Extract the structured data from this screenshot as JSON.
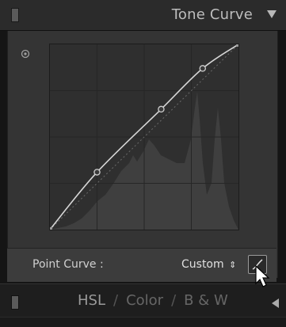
{
  "header": {
    "title": "Tone Curve",
    "icons": [
      "panel-grip",
      "collapse-triangle"
    ]
  },
  "curve": {
    "control_points": [
      [
        0,
        0
      ],
      [
        0.25,
        0.31
      ],
      [
        0.59,
        0.65
      ],
      [
        0.81,
        0.87
      ],
      [
        1,
        1
      ]
    ],
    "icons": [
      "target-adjust-icon"
    ]
  },
  "footer": {
    "label": "Point Curve :",
    "select_value": "Custom",
    "select_arrows": "⇕",
    "icons": [
      "edit-point-curve-icon"
    ]
  },
  "bottom": {
    "tabs": [
      "HSL",
      "Color",
      "B & W"
    ],
    "separator": "/",
    "icons": [
      "panel-grip",
      "expand-left-triangle"
    ]
  }
}
